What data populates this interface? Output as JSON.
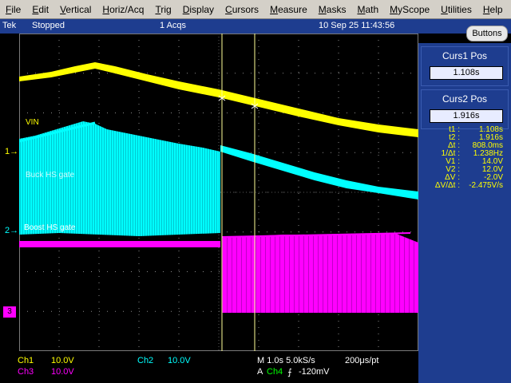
{
  "menu": [
    "File",
    "Edit",
    "Vertical",
    "Horiz/Acq",
    "Trig",
    "Display",
    "Cursors",
    "Measure",
    "Masks",
    "Math",
    "MyScope",
    "Utilities",
    "Help"
  ],
  "status": {
    "brand": "Tek",
    "state": "Stopped",
    "acqs": "1 Acqs",
    "datetime": "10 Sep 25 11:43:56",
    "buttons_label": "Buttons"
  },
  "cursors": {
    "curs1_title": "Curs1 Pos",
    "curs1_value": "1.108s",
    "curs2_title": "Curs2 Pos",
    "curs2_value": "1.916s"
  },
  "readouts": [
    {
      "k": "t1 :",
      "v": "1.108s"
    },
    {
      "k": "t2 :",
      "v": "1.916s"
    },
    {
      "k": "Δt :",
      "v": "808.0ms"
    },
    {
      "k": "1/Δt :",
      "v": "1.238Hz"
    },
    {
      "k": "V1 :",
      "v": "14.0V"
    },
    {
      "k": "V2 :",
      "v": "12.0V"
    },
    {
      "k": "ΔV :",
      "v": "-2.0V"
    },
    {
      "k": "ΔV/Δt :",
      "v": "-2.475V/s"
    }
  ],
  "trace_labels": {
    "vin": "VIN",
    "buck": "Buck HS gate",
    "boost": "Boost HS gate",
    "marker1": "1",
    "marker2": "2",
    "marker3": "3"
  },
  "channels": {
    "ch1_name": "Ch1",
    "ch1_scale": "10.0V",
    "ch2_name": "Ch2",
    "ch2_scale": "10.0V",
    "ch3_name": "Ch3",
    "ch3_scale": "10.0V"
  },
  "timebase": {
    "horizontal": "M 1.0s 5.0kS/s",
    "resolution": "200μs/pt",
    "trigger_prefix": "A",
    "trigger_source": "Ch4",
    "trigger_slope": "⨍",
    "trigger_level": "-120mV"
  },
  "colors": {
    "ch1": "#ffff00",
    "ch2": "#00ffff",
    "ch3": "#ff00ff",
    "ch4": "#00ff00",
    "panel": "#1e3d8f"
  }
}
